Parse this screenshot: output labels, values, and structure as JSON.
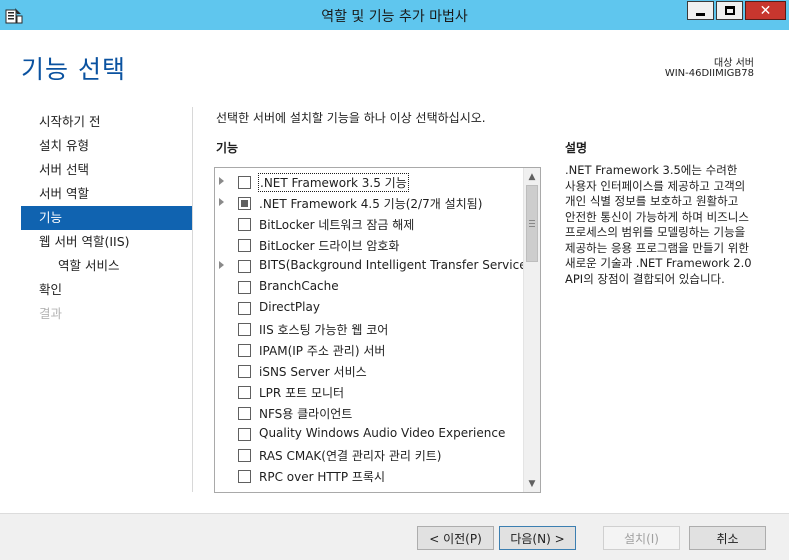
{
  "window": {
    "title": "역할 및 기능 추가 마법사",
    "icon": "server-manager-wizard-icon",
    "controls": {
      "minimize": "minimize-icon",
      "maximize": "maximize-icon",
      "close": "✕"
    }
  },
  "header": {
    "page_title": "기능 선택",
    "target_label": "대상 서버",
    "target_server": "WIN-46DIIMIGB78"
  },
  "nav": {
    "items": [
      {
        "label": "시작하기 전",
        "state": "normal"
      },
      {
        "label": "설치 유형",
        "state": "normal"
      },
      {
        "label": "서버 선택",
        "state": "normal"
      },
      {
        "label": "서버 역할",
        "state": "normal"
      },
      {
        "label": "기능",
        "state": "active"
      },
      {
        "label": "웹 서버 역할(IIS)",
        "state": "normal"
      },
      {
        "label": "역할 서비스",
        "state": "sub"
      },
      {
        "label": "확인",
        "state": "normal"
      },
      {
        "label": "결과",
        "state": "disabled"
      }
    ]
  },
  "content": {
    "instruction": "선택한 서버에 설치할 기능을 하나 이상 선택하십시오.",
    "features_heading": "기능",
    "features": [
      {
        "label": ".NET Framework 3.5 기능",
        "expandable": true,
        "state": "unchecked",
        "selected": true
      },
      {
        "label": ".NET Framework 4.5 기능(2/7개 설치됨)",
        "expandable": true,
        "state": "partial",
        "selected": false
      },
      {
        "label": "BitLocker 네트워크 잠금 해제",
        "expandable": false,
        "state": "unchecked",
        "selected": false
      },
      {
        "label": "BitLocker 드라이브 암호화",
        "expandable": false,
        "state": "unchecked",
        "selected": false
      },
      {
        "label": "BITS(Background Intelligent Transfer Service)",
        "expandable": true,
        "state": "unchecked",
        "selected": false
      },
      {
        "label": "BranchCache",
        "expandable": false,
        "state": "unchecked",
        "selected": false
      },
      {
        "label": "DirectPlay",
        "expandable": false,
        "state": "unchecked",
        "selected": false
      },
      {
        "label": "IIS 호스팅 가능한 웹 코어",
        "expandable": false,
        "state": "unchecked",
        "selected": false
      },
      {
        "label": "IPAM(IP 주소 관리) 서버",
        "expandable": false,
        "state": "unchecked",
        "selected": false
      },
      {
        "label": "iSNS Server 서비스",
        "expandable": false,
        "state": "unchecked",
        "selected": false
      },
      {
        "label": "LPR 포트 모니터",
        "expandable": false,
        "state": "unchecked",
        "selected": false
      },
      {
        "label": "NFS용 클라이언트",
        "expandable": false,
        "state": "unchecked",
        "selected": false
      },
      {
        "label": "Quality Windows Audio Video Experience",
        "expandable": false,
        "state": "unchecked",
        "selected": false
      },
      {
        "label": "RAS CMAK(연결 관리자 관리 키트)",
        "expandable": false,
        "state": "unchecked",
        "selected": false
      },
      {
        "label": "RPC over HTTP 프록시",
        "expandable": false,
        "state": "unchecked",
        "selected": false
      }
    ],
    "description_heading": "설명",
    "description": ".NET Framework 3.5에는 수려한 사용자 인터페이스를 제공하고 고객의 개인 식별 정보를 보호하고 원활하고 안전한 통신이 가능하게 하며 비즈니스 프로세스의 범위를 모델링하는 기능을 제공하는 응용 프로그램을 만들기 위한 새로운 기술과 .NET Framework 2.0 API의 장점이 결합되어 있습니다."
  },
  "buttons": {
    "previous": "< 이전(P)",
    "next": "다음(N) >",
    "install": "설치(I)",
    "cancel": "취소"
  },
  "colors": {
    "titlebar": "#5fc6ee",
    "accent": "#1063b0",
    "page_title": "#0a52a0",
    "close_button": "#c7362e"
  }
}
